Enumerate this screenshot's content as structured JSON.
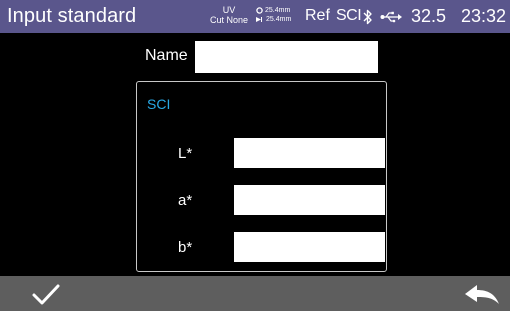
{
  "status_bar": {
    "title": "Input standard",
    "uv_line1": "UV",
    "uv_line2": "Cut None",
    "aperture_measure": "25.4mm",
    "aperture_light": "25.4mm",
    "mode": "Ref",
    "spec": "SCI",
    "temperature": "32.5",
    "time": "23:32",
    "icons": [
      "bluetooth-icon",
      "usb-icon"
    ]
  },
  "form": {
    "name_label": "Name",
    "name_value": "",
    "section_title": "SCI",
    "fields": [
      {
        "label": "L*",
        "value": ""
      },
      {
        "label": "a*",
        "value": ""
      },
      {
        "label": "b*",
        "value": ""
      }
    ]
  },
  "bottom_bar": {
    "icons": [
      "confirm-check-icon",
      "back-arrow-icon"
    ]
  },
  "colors": {
    "status_bar_bg": "#5a568c",
    "bottom_bar_bg": "#5e5e5e",
    "section_title": "#28a9e6",
    "background": "#000000"
  }
}
